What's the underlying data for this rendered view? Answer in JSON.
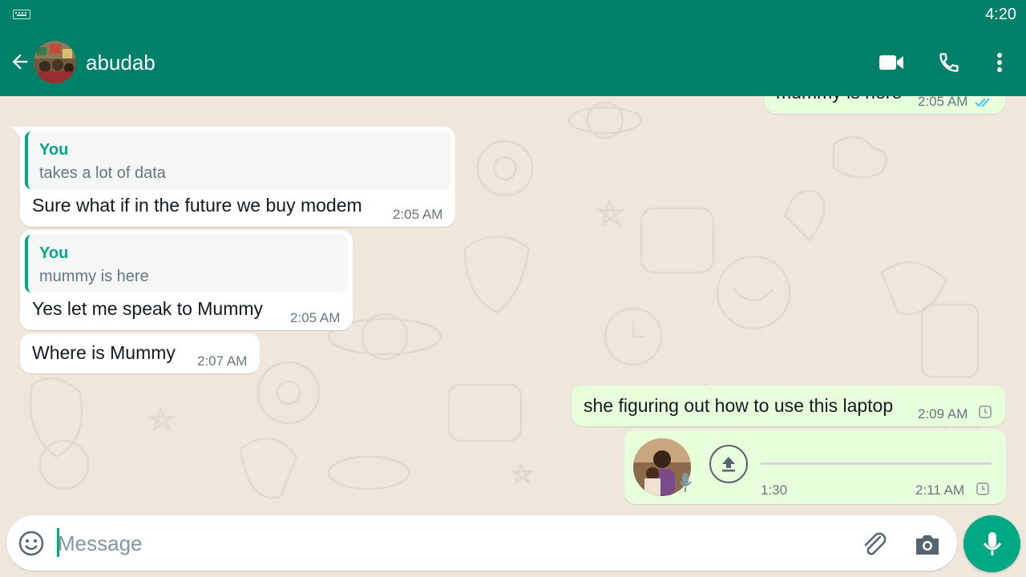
{
  "status_bar": {
    "time": "4:20",
    "keyboard_icon": "keyboard-icon"
  },
  "header": {
    "contact_name": "abudab",
    "back_icon": "arrow-left-icon",
    "video_icon": "video-call-icon",
    "call_icon": "phone-icon",
    "menu_icon": "more-vert-icon",
    "bg_color": "#008069"
  },
  "messages": [
    {
      "direction": "outgoing",
      "text": "mummy is here",
      "time": "2:05 AM",
      "status": "read"
    },
    {
      "direction": "incoming",
      "quote": {
        "author": "You",
        "text": "takes a lot of data"
      },
      "text": "Sure what if in the future we buy modem",
      "time": "2:05 AM"
    },
    {
      "direction": "incoming",
      "quote": {
        "author": "You",
        "text": "mummy is here"
      },
      "text": "Yes let me speak to Mummy",
      "time": "2:05 AM"
    },
    {
      "direction": "incoming",
      "text": "Where is Mummy",
      "time": "2:07 AM"
    },
    {
      "direction": "outgoing",
      "text": "she figuring out how to use this laptop",
      "time": "2:09 AM",
      "status": "pending"
    },
    {
      "direction": "outgoing",
      "type": "voice",
      "duration": "1:30",
      "time": "2:11 AM",
      "status": "pending",
      "progress": 0
    }
  ],
  "input": {
    "placeholder": "Message"
  },
  "colors": {
    "accent": "#00a884",
    "outgoing_bubble": "#e7ffdb",
    "incoming_bubble": "#ffffff",
    "chat_bg": "#efe7dc",
    "read_tick": "#53bdeb"
  }
}
